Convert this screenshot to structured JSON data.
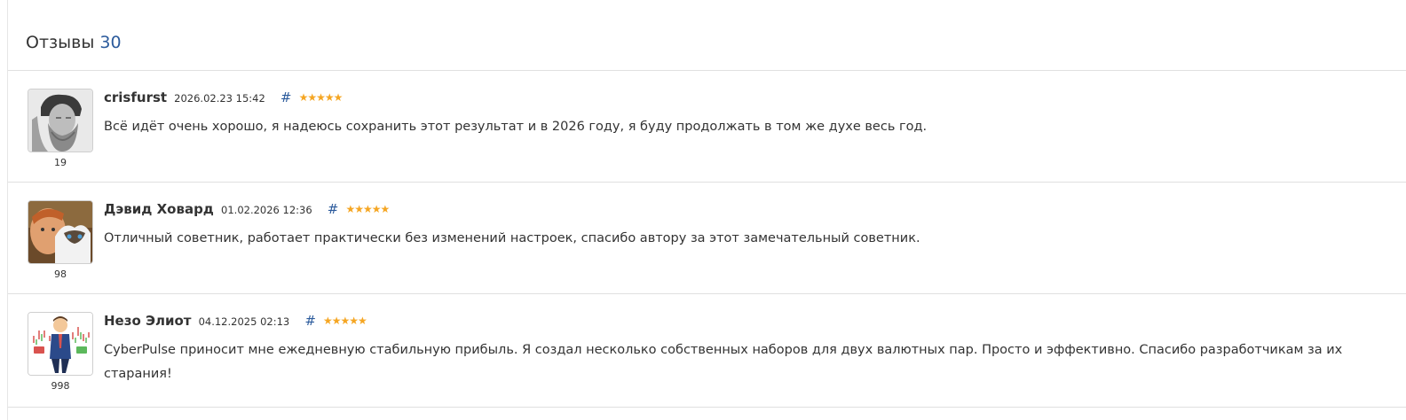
{
  "header": {
    "title": "Отзывы",
    "count": "30"
  },
  "reviews": [
    {
      "author": "crisfurst",
      "date": "2026.02.23 15:42",
      "anchor": "#",
      "stars": "★★★★★",
      "rating": 5,
      "user_rating": "19",
      "text": "Всё идёт очень хорошо, я надеюсь сохранить этот результат и в 2026 году, я буду продолжать в том же духе весь год.",
      "avatar_icon": "portrait-sketch-avatar"
    },
    {
      "author": "Дэвид Ховард",
      "date": "01.02.2026 12:36",
      "anchor": "#",
      "stars": "★★★★★",
      "rating": 5,
      "user_rating": "98",
      "text": "Отличный советник, работает практически без изменений настроек, спасибо автору за этот замечательный советник.",
      "avatar_icon": "man-with-cat-avatar"
    },
    {
      "author": "Незо Элиот",
      "date": "04.12.2025 02:13",
      "anchor": "#",
      "stars": "★★★★★",
      "rating": 5,
      "user_rating": "998",
      "text": "CyberPulse приносит мне ежедневную стабильную прибыль. Я создал несколько собственных наборов для двух валютных пар. Просто и эффективно. Спасибо разработчикам за их старания!",
      "avatar_icon": "trader-cartoon-avatar"
    }
  ],
  "colors": {
    "accent": "#2c5b9c",
    "star": "#f5a623",
    "divider": "#e0e0e0"
  }
}
